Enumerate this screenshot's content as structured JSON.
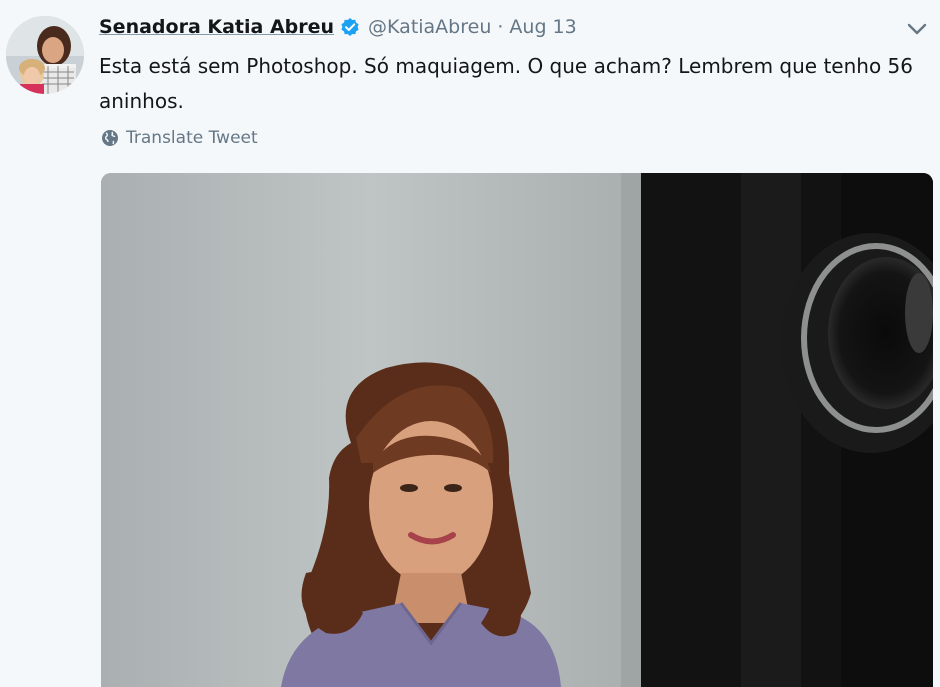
{
  "tweet": {
    "author_name": "Senadora Katia Abreu",
    "handle": "@KatiaAbreu",
    "separator": "·",
    "date": "Aug 13",
    "text": "Esta está sem Photoshop. Só maquiagem. O que acham? Lembrem que tenho 56 aninhos.",
    "translate_label": "Translate Tweet"
  },
  "icons": {
    "verified": "verified-badge-icon",
    "caret": "chevron-down-icon",
    "globe": "globe-icon"
  },
  "colors": {
    "background": "#f5f8fa",
    "name": "#14171a",
    "muted": "#657786",
    "verified": "#1da1f2"
  }
}
